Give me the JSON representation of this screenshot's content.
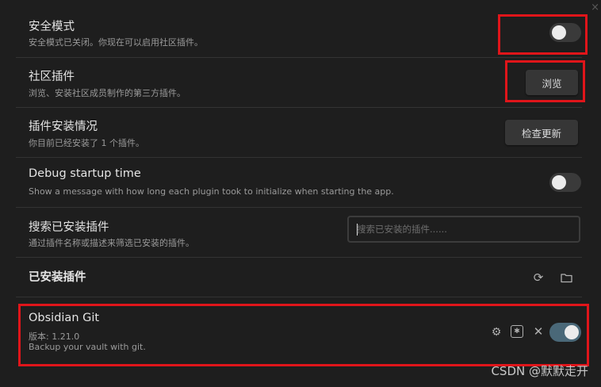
{
  "safe_mode": {
    "title": "安全模式",
    "desc": "安全模式已关闭。你现在可以启用社区插件。",
    "toggle_on": false
  },
  "community": {
    "title": "社区插件",
    "desc": "浏览、安装社区成员制作的第三方插件。",
    "browse_label": "浏览"
  },
  "installed_status": {
    "title": "插件安装情况",
    "desc": "你目前已经安装了 1 个插件。",
    "check_label": "检查更新"
  },
  "debug": {
    "title": "Debug startup time",
    "desc": "Show a message with how long each plugin took to initialize when starting the app.",
    "toggle_on": false
  },
  "search": {
    "title": "搜索已安装插件",
    "desc": "通过插件名称或描述来筛选已安装的插件。",
    "placeholder": "搜索已安装的插件......"
  },
  "installed_section": {
    "heading": "已安装插件"
  },
  "plugin": {
    "name": "Obsidian Git",
    "version": "版本: 1.21.0",
    "desc": "Backup your vault with git.",
    "enabled": true
  },
  "icons": {
    "close": "×",
    "reload": "⟳",
    "folder": "folder",
    "gear": "⚙",
    "hotkey": "✱",
    "uninstall": "✕"
  },
  "watermark": "CSDN @默默走开",
  "colors": {
    "highlight": "#e0151a",
    "toggle_on": "#4a6878"
  }
}
